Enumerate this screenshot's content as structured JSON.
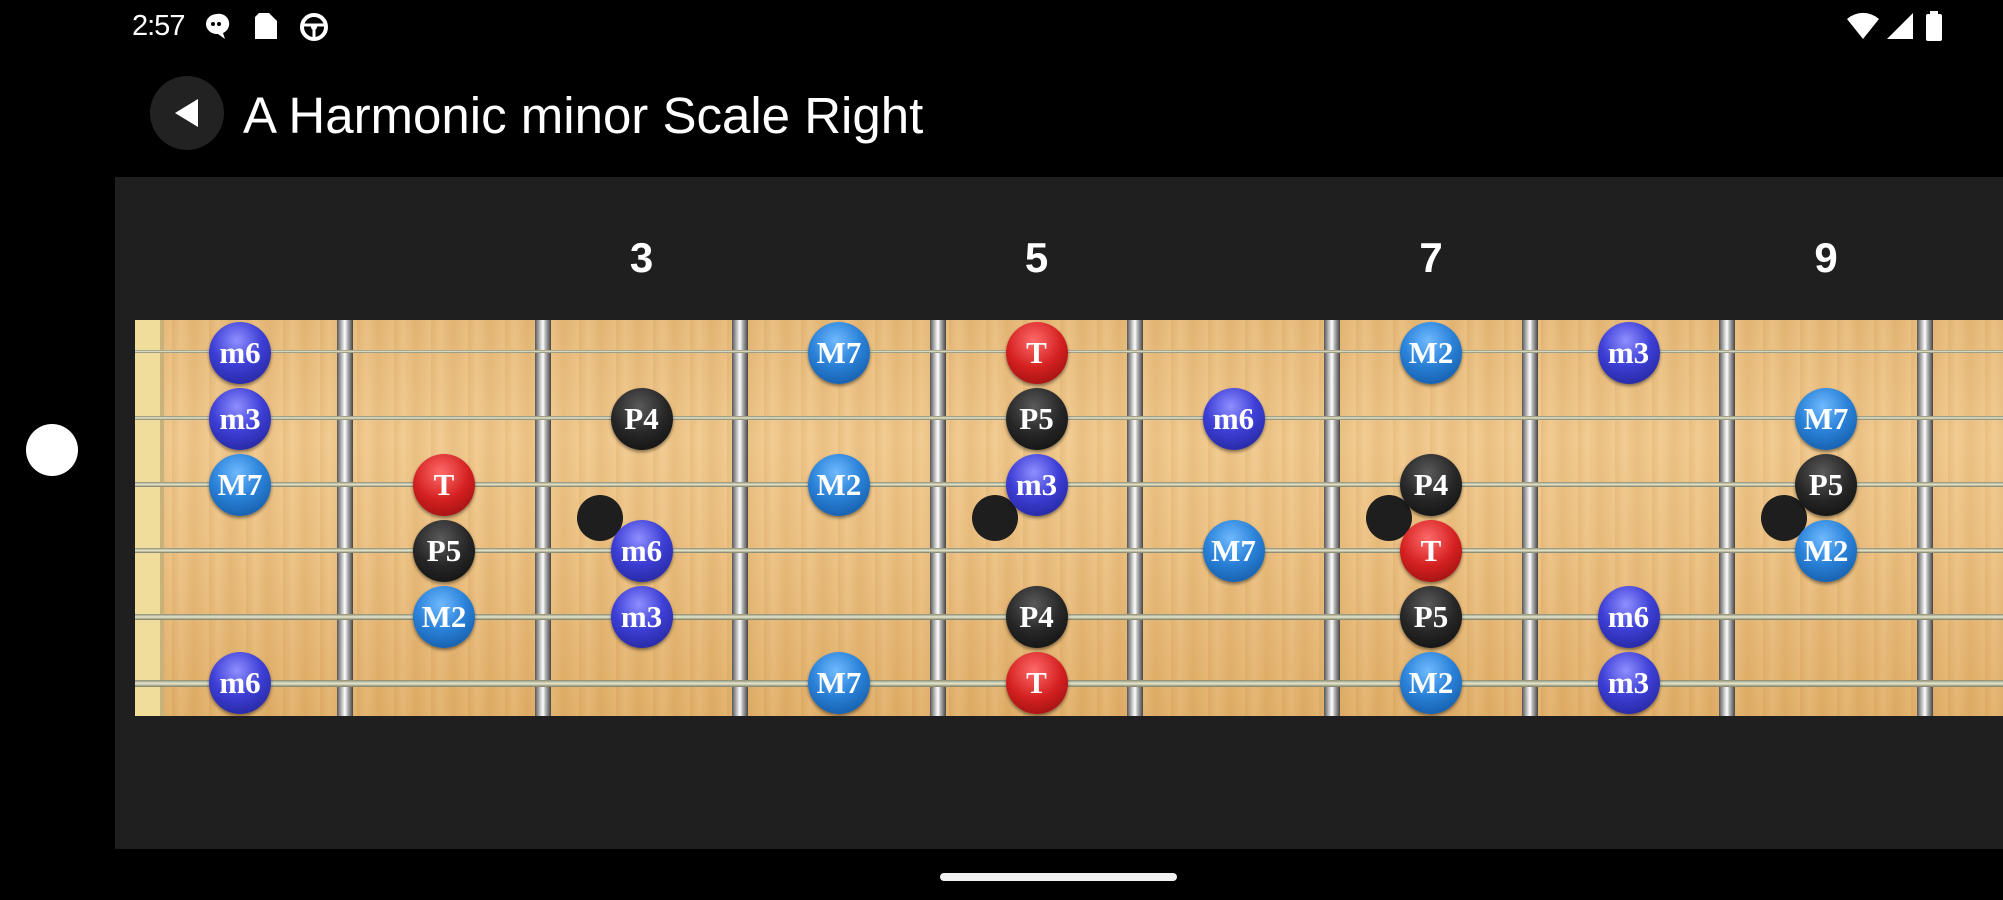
{
  "status_bar": {
    "time": "2:57",
    "left_icons": [
      "chat-icon",
      "sim-card-icon",
      "steering-wheel-icon"
    ],
    "right_icons": [
      "wifi-icon",
      "cell-signal-icon",
      "battery-icon"
    ]
  },
  "app_bar": {
    "back_icon": "back-arrow-icon",
    "title": "A Harmonic minor Scale Right"
  },
  "fretboard": {
    "fret_numbers": [
      "3",
      "5",
      "7",
      "9"
    ],
    "strings": 6,
    "notes": [
      {
        "string": 1,
        "fret": 1,
        "label": "m6",
        "color": "purple"
      },
      {
        "string": 1,
        "fret": 4,
        "label": "M7",
        "color": "blue"
      },
      {
        "string": 1,
        "fret": 5,
        "label": "T",
        "color": "red"
      },
      {
        "string": 1,
        "fret": 7,
        "label": "M2",
        "color": "blue"
      },
      {
        "string": 1,
        "fret": 8,
        "label": "m3",
        "color": "purple"
      },
      {
        "string": 2,
        "fret": 1,
        "label": "m3",
        "color": "purple"
      },
      {
        "string": 2,
        "fret": 3,
        "label": "P4",
        "color": "black"
      },
      {
        "string": 2,
        "fret": 5,
        "label": "P5",
        "color": "black"
      },
      {
        "string": 2,
        "fret": 6,
        "label": "m6",
        "color": "purple"
      },
      {
        "string": 2,
        "fret": 9,
        "label": "M7",
        "color": "blue"
      },
      {
        "string": 3,
        "fret": 1,
        "label": "M7",
        "color": "blue"
      },
      {
        "string": 3,
        "fret": 2,
        "label": "T",
        "color": "red"
      },
      {
        "string": 3,
        "fret": 4,
        "label": "M2",
        "color": "blue"
      },
      {
        "string": 3,
        "fret": 5,
        "label": "m3",
        "color": "purple"
      },
      {
        "string": 3,
        "fret": 7,
        "label": "P4",
        "color": "black"
      },
      {
        "string": 3,
        "fret": 9,
        "label": "P5",
        "color": "black"
      },
      {
        "string": 4,
        "fret": 2,
        "label": "P5",
        "color": "black"
      },
      {
        "string": 4,
        "fret": 3,
        "label": "m6",
        "color": "purple"
      },
      {
        "string": 4,
        "fret": 6,
        "label": "M7",
        "color": "blue"
      },
      {
        "string": 4,
        "fret": 7,
        "label": "T",
        "color": "red"
      },
      {
        "string": 4,
        "fret": 9,
        "label": "M2",
        "color": "blue"
      },
      {
        "string": 5,
        "fret": 2,
        "label": "M2",
        "color": "blue"
      },
      {
        "string": 5,
        "fret": 3,
        "label": "m3",
        "color": "purple"
      },
      {
        "string": 5,
        "fret": 5,
        "label": "P4",
        "color": "black"
      },
      {
        "string": 5,
        "fret": 7,
        "label": "P5",
        "color": "black"
      },
      {
        "string": 5,
        "fret": 8,
        "label": "m6",
        "color": "purple"
      },
      {
        "string": 6,
        "fret": 1,
        "label": "m6",
        "color": "purple"
      },
      {
        "string": 6,
        "fret": 4,
        "label": "M7",
        "color": "blue"
      },
      {
        "string": 6,
        "fret": 5,
        "label": "T",
        "color": "red"
      },
      {
        "string": 6,
        "fret": 7,
        "label": "M2",
        "color": "blue"
      },
      {
        "string": 6,
        "fret": 8,
        "label": "m3",
        "color": "purple"
      }
    ],
    "inlay_frets": [
      3,
      5,
      7,
      9
    ]
  },
  "colors": {
    "background": "#000000",
    "content_bg": "#1f1f1f",
    "wood": "#ecc080",
    "blue_note": "#2a82d8",
    "purple_note": "#3d3fd6",
    "red_note": "#d42020",
    "black_note": "#262626"
  }
}
